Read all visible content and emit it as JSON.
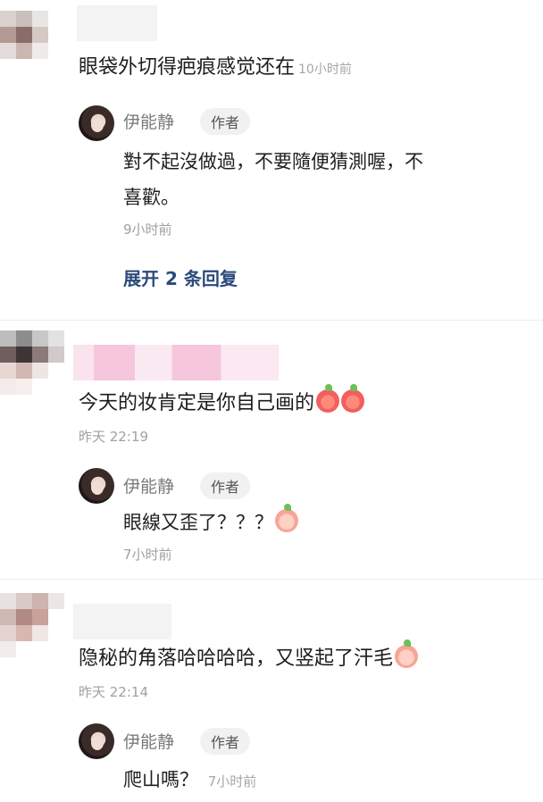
{
  "comments": [
    {
      "text": "眼袋外切得疤痕感觉还在",
      "time": "10小时前",
      "reply": {
        "name": "伊能静",
        "badge": "作者",
        "text_line1": "對不起沒做過，不要隨便猜測喔，不",
        "text_line2": "喜歡。",
        "time": "9小时前"
      },
      "expand_label": "展开 2 条回复"
    },
    {
      "text": "今天的妆肯定是你自己画的",
      "emoji": [
        "crying-laugh-icon",
        "grin-icon"
      ],
      "time": "昨天 22:19",
      "reply": {
        "name": "伊能静",
        "badge": "作者",
        "text": "眼線又歪了？？？",
        "emoji": "facepalm-icon",
        "time": "7小时前"
      }
    },
    {
      "text": "隐秘的角落哈哈哈哈，又竖起了汗毛",
      "emoji": "shock-icon",
      "time": "昨天 22:14",
      "reply": {
        "name": "伊能静",
        "badge": "作者",
        "text": "爬山嗎？",
        "time": "7小时前"
      }
    }
  ],
  "colors": {
    "link": "#2a4a7a",
    "muted": "#a0a0a0",
    "badge_bg": "#f1f1f1"
  }
}
